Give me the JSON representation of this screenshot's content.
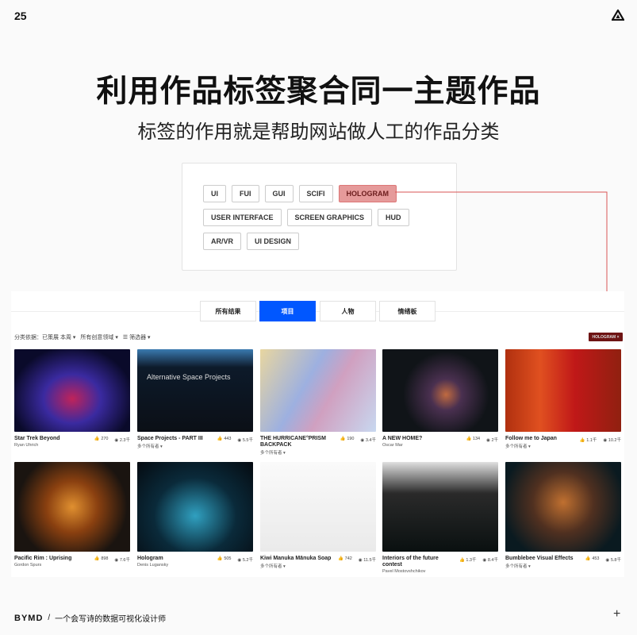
{
  "page_number": "25",
  "logo": "triangle-logo",
  "title": "利用作品标签聚合同一主题作品",
  "subtitle": "标签的作用就是帮助网站做人工的作品分类",
  "tags": [
    "UI",
    "FUI",
    "GUI",
    "SCIFI",
    "HOLOGRAM",
    "USER INTERFACE",
    "SCREEN GRAPHICS",
    "HUD",
    "AR/VR",
    "UI DESIGN"
  ],
  "selected_tag": "HOLOGRAM",
  "tabs": [
    "所有结果",
    "项目",
    "人物",
    "情绪板"
  ],
  "active_tab": "项目",
  "filters": [
    "分类依据：已策展 本周 ▾",
    "所有创意领域 ▾",
    "☰ 筛选器 ▾"
  ],
  "active_filter_badge": "HOLOGRAM ×",
  "accent": "#0057ff",
  "highlight": "#d95555",
  "cards": [
    {
      "title": "Star Trek Beyond",
      "author": "Ryan Uhrich",
      "likes": "270",
      "views": "2.3千"
    },
    {
      "title": "Space Projects - PART III",
      "author": "多个所有者 ▾",
      "likes": "443",
      "views": "5.5千",
      "image_text": "Alternative Space Projects"
    },
    {
      "title": "THE HURRICANE°PRISM BACKPACK",
      "author": "多个所有者 ▾",
      "likes": "190",
      "views": "3.4千"
    },
    {
      "title": "A NEW HOME?",
      "author": "Oscar Mar",
      "likes": "134",
      "views": "2千"
    },
    {
      "title": "Follow me to Japan",
      "author": "多个所有者 ▾",
      "likes": "1.1千",
      "views": "10.2千"
    },
    {
      "title": "Pacific Rim : Uprising",
      "author": "Gordon Spurs",
      "likes": "898",
      "views": "7.6千"
    },
    {
      "title": "Hologram",
      "author": "Denis Lugansky",
      "likes": "505",
      "views": "5.2千"
    },
    {
      "title": "Kiwi Manuka Mānuka Soap",
      "author": "多个所有者 ▾",
      "likes": "742",
      "views": "11.5千"
    },
    {
      "title": "Interiors of the future contest",
      "author": "Pavel Mostovshchikov",
      "likes": "1.3千",
      "views": "8.4千"
    },
    {
      "title": "Bumblebee Visual Effects",
      "author": "多个所有者 ▾",
      "likes": "453",
      "views": "5.8千"
    }
  ],
  "footer": {
    "brand": "BYMD",
    "separator": "/",
    "tagline": "一个会写诗的数据可视化设计师",
    "plus": "+"
  }
}
